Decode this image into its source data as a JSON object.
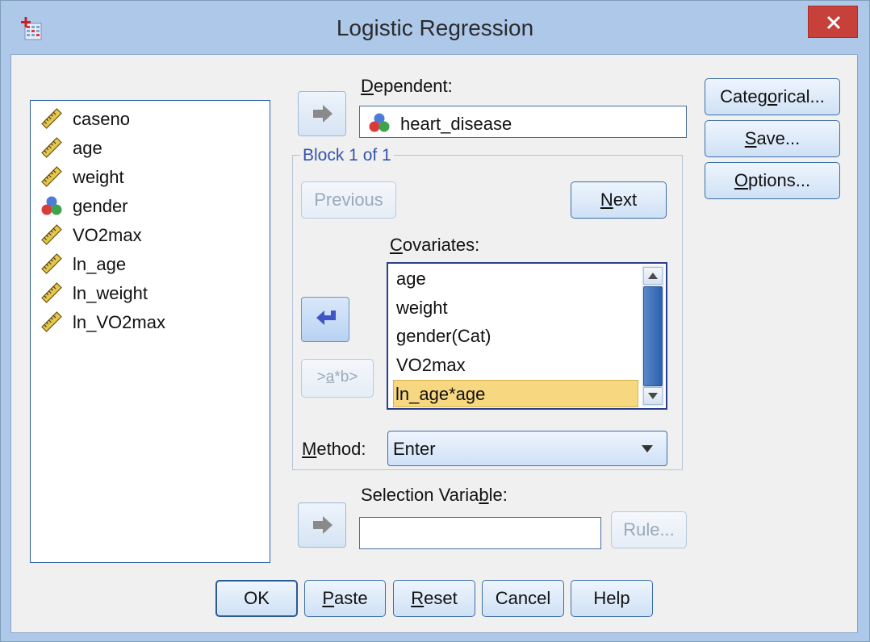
{
  "window": {
    "title": "Logistic Regression"
  },
  "variables": [
    {
      "name": "caseno",
      "icon": "ruler-scale-icon"
    },
    {
      "name": "age",
      "icon": "ruler-scale-icon"
    },
    {
      "name": "weight",
      "icon": "ruler-scale-icon"
    },
    {
      "name": "gender",
      "icon": "nominal-balls-icon"
    },
    {
      "name": "VO2max",
      "icon": "ruler-scale-icon"
    },
    {
      "name": "ln_age",
      "icon": "ruler-scale-icon"
    },
    {
      "name": "ln_weight",
      "icon": "ruler-scale-icon"
    },
    {
      "name": "ln_VO2max",
      "icon": "ruler-scale-icon"
    }
  ],
  "dependent": {
    "label_u": "D",
    "label_rest": "ependent:",
    "value": "heart_disease"
  },
  "block": {
    "title": "Block 1 of 1",
    "previous": "Previous",
    "next_u": "N",
    "next_rest": "ext"
  },
  "covariates": {
    "label_u": "C",
    "label_rest": "ovariates:",
    "items": [
      "age",
      "weight",
      "gender(Cat)",
      "VO2max",
      "ln_age*age"
    ],
    "selected_index": 4
  },
  "interaction_button": {
    "pre": ">",
    "u": "a",
    "post": "*b>"
  },
  "method": {
    "label_u": "M",
    "label_rest": "ethod:",
    "value": "Enter"
  },
  "selection": {
    "label_pre": "Selection Varia",
    "label_u": "b",
    "label_post": "le:",
    "value": "",
    "rule": "Rule..."
  },
  "side_buttons": {
    "categorical_pre": "Categ",
    "categorical_u": "o",
    "categorical_post": "rical...",
    "save_u": "S",
    "save_rest": "ave...",
    "options_u": "O",
    "options_rest": "ptions..."
  },
  "footer": {
    "ok": "OK",
    "paste_u": "P",
    "paste_rest": "aste",
    "reset_u": "R",
    "reset_rest": "eset",
    "cancel": "Cancel",
    "help": "Help"
  },
  "colors": {
    "window_bg": "#aec8ea",
    "client_bg": "#f0f0f0",
    "close_red": "#c7413a",
    "selected_row": "#f7d780",
    "scroll_thumb": "#2c5fae"
  }
}
